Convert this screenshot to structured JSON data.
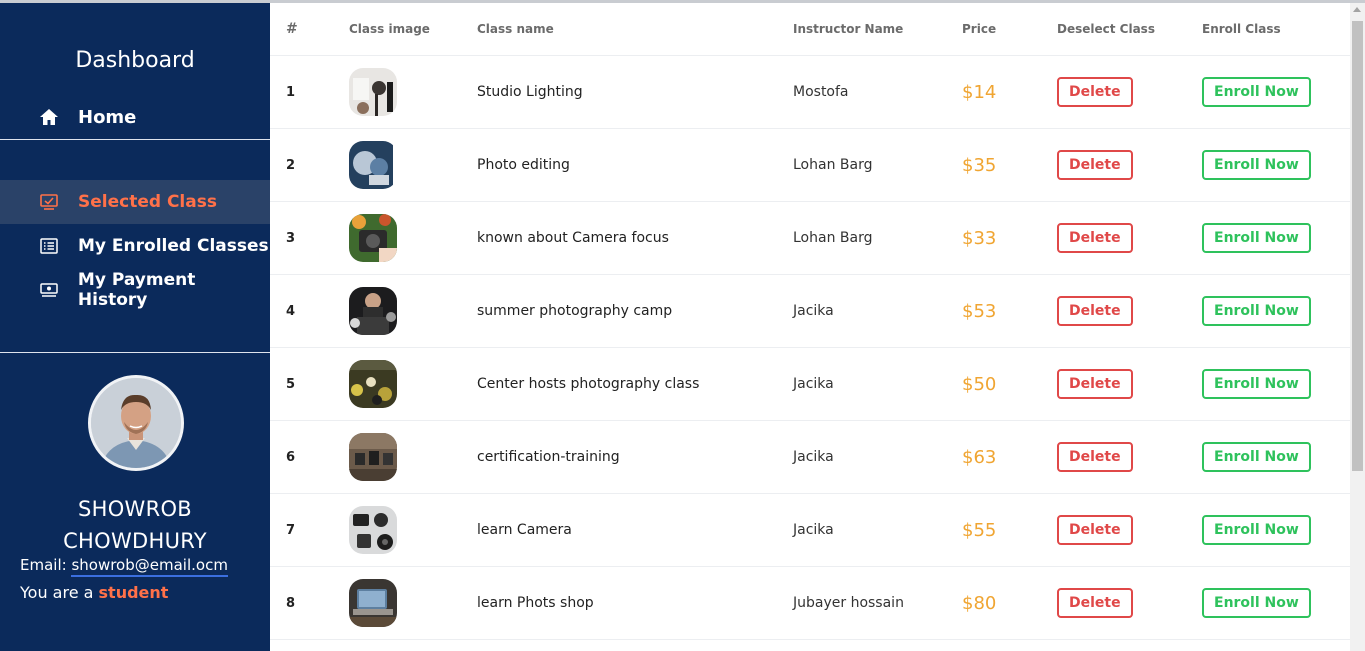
{
  "sidebar": {
    "title": "Dashboard",
    "home_label": "Home",
    "nav": [
      {
        "label": "Selected Class",
        "icon": "checklist-icon"
      },
      {
        "label": "My Enrolled Classes",
        "icon": "list-icon"
      },
      {
        "label": "My Payment History",
        "icon": "money-icon"
      }
    ],
    "user": {
      "name_line1": "SHOWROB",
      "name_line2": "CHOWDHURY",
      "email_label": "Email:",
      "email": "showrob@email.ocm",
      "role_prefix": "You are a",
      "role": "student"
    }
  },
  "table": {
    "headers": [
      "#",
      "Class image",
      "Class name",
      "Instructor Name",
      "Price",
      "Deselect Class",
      "Enroll Class"
    ],
    "delete_label": "Delete",
    "enroll_label": "Enroll Now",
    "rows": [
      {
        "num": "1",
        "name": "Studio Lighting",
        "instructor": "Mostofa",
        "price": "$14"
      },
      {
        "num": "2",
        "name": "Photo editing",
        "instructor": "Lohan Barg",
        "price": "$35"
      },
      {
        "num": "3",
        "name": "known about Camera focus",
        "instructor": "Lohan Barg",
        "price": "$33"
      },
      {
        "num": "4",
        "name": "summer photography camp",
        "instructor": "Jacika",
        "price": "$53"
      },
      {
        "num": "5",
        "name": "Center hosts photography class",
        "instructor": "Jacika",
        "price": "$50"
      },
      {
        "num": "6",
        "name": "certification-training",
        "instructor": "Jacika",
        "price": "$63"
      },
      {
        "num": "7",
        "name": "learn Camera",
        "instructor": "Jacika",
        "price": "$55"
      },
      {
        "num": "8",
        "name": "learn Phots shop",
        "instructor": "Jubayer hossain",
        "price": "$80"
      }
    ]
  },
  "colors": {
    "sidebar_bg": "#0b2a5b",
    "accent_orange": "#ff7149",
    "price": "#f0a532",
    "delete": "#e04848",
    "enroll": "#2ec25c"
  }
}
